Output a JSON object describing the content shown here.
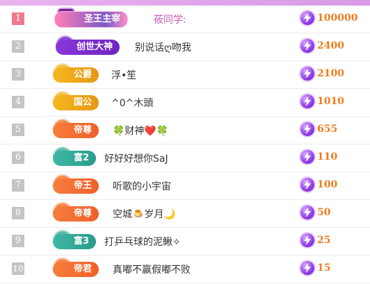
{
  "header": {},
  "rows": [
    {
      "rank": "1",
      "badge": "圣王主宰",
      "name": "莜同学:",
      "score": "100000"
    },
    {
      "rank": "2",
      "badge": "创世大神",
      "name": "别说话ღ吻我",
      "score": "2400"
    },
    {
      "rank": "3",
      "badge": "公爵",
      "name": "浮•笙",
      "score": "2100"
    },
    {
      "rank": "4",
      "badge": "国公",
      "name": "^0^木頭",
      "score": "1010"
    },
    {
      "rank": "5",
      "badge": "帝尊",
      "name": "🍀财神❤️🍀",
      "score": "655"
    },
    {
      "rank": "6",
      "badge": "富2",
      "name": "好好好想你SaJ",
      "score": "110"
    },
    {
      "rank": "7",
      "badge": "帝王",
      "name": "听歌的小宇宙",
      "score": "100"
    },
    {
      "rank": "8",
      "badge": "帝尊",
      "name": "空城🍮岁月🌙",
      "score": "50"
    },
    {
      "rank": "9",
      "badge": "富3",
      "name": "打乒乓球的泥鳅✧",
      "score": "25"
    },
    {
      "rank": "10",
      "badge": "帝君",
      "name": "真嘟不赢假嘟不败",
      "score": "15"
    }
  ],
  "icons": {
    "rank_badge": "crown-emblem-icon",
    "coin": "lightning-coin-icon"
  },
  "colors": {
    "score": "#f07b1c",
    "rank_first": "#f07a8e",
    "rank_default": "#c4c4c4",
    "accent_bar": "#d79ae6"
  }
}
